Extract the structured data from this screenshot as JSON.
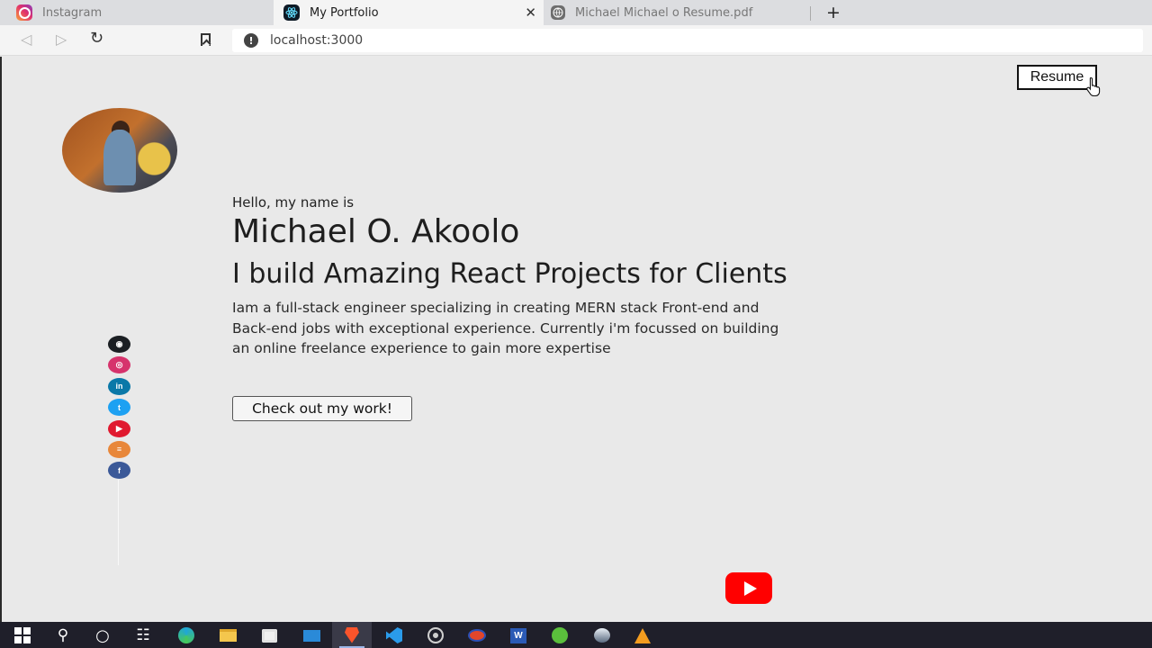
{
  "browser": {
    "tabs": [
      {
        "title": "Instagram",
        "icon": "instagram-icon"
      },
      {
        "title": "My Portfolio",
        "icon": "react-icon",
        "active": true
      },
      {
        "title": "Michael Michael o Resume.pdf",
        "icon": "globe-icon"
      }
    ],
    "close_glyph": "✕",
    "new_tab_glyph": "+",
    "back_glyph": "◁",
    "forward_glyph": "▷",
    "reload_glyph": "↻",
    "info_glyph": "!",
    "url": "localhost:3000"
  },
  "page": {
    "resume_label": "Resume",
    "intro": "Hello, my name is",
    "name": "Michael O. Akoolo",
    "tagline": "I build Amazing React Projects for Clients",
    "bio": "Iam a full-stack engineer specializing in creating MERN stack Front-end and Back-end jobs with exceptional experience. Currently i'm focussed on building an online freelance experience to gain more expertise",
    "cta_label": "Check out my work!",
    "social": [
      {
        "name": "github-icon",
        "color": "#1b1f23",
        "glyph": "◉"
      },
      {
        "name": "instagram-icon",
        "color": "#d6336c",
        "glyph": "◎"
      },
      {
        "name": "linkedin-icon",
        "color": "#0a78a8",
        "glyph": "in"
      },
      {
        "name": "twitter-icon",
        "color": "#1da1f2",
        "glyph": "t"
      },
      {
        "name": "youtube-icon",
        "color": "#e0192f",
        "glyph": "▶"
      },
      {
        "name": "stackoverflow-icon",
        "color": "#e8873a",
        "glyph": "≡"
      },
      {
        "name": "facebook-icon",
        "color": "#3b5998",
        "glyph": "f"
      }
    ]
  },
  "overlay": {
    "youtube_color": "#ff0000"
  },
  "taskbar": {
    "items": [
      {
        "name": "windows-start-icon"
      },
      {
        "name": "search-icon",
        "glyph": "⚲"
      },
      {
        "name": "cortana-icon",
        "glyph": "○"
      },
      {
        "name": "task-view-icon",
        "glyph": "☷"
      },
      {
        "name": "edge-icon",
        "color": "#1fa6d8"
      },
      {
        "name": "file-explorer-icon",
        "color": "#f4c64d"
      },
      {
        "name": "store-icon",
        "color": "#f0f0f0"
      },
      {
        "name": "mail-icon",
        "color": "#2a8ad8"
      },
      {
        "name": "brave-icon",
        "color": "#fb542b",
        "active": true
      },
      {
        "name": "vscode-icon",
        "color": "#2a9bea"
      },
      {
        "name": "chrome-icon",
        "color": "#cfcfcf"
      },
      {
        "name": "app-icon",
        "color": "#e2462b"
      },
      {
        "name": "word-icon",
        "color": "#2b5ab5"
      },
      {
        "name": "green-app-icon",
        "color": "#5abf3c"
      },
      {
        "name": "sphere-app-icon",
        "color": "#9aa9bb"
      },
      {
        "name": "vlc-icon",
        "color": "#f39c1f"
      }
    ]
  }
}
